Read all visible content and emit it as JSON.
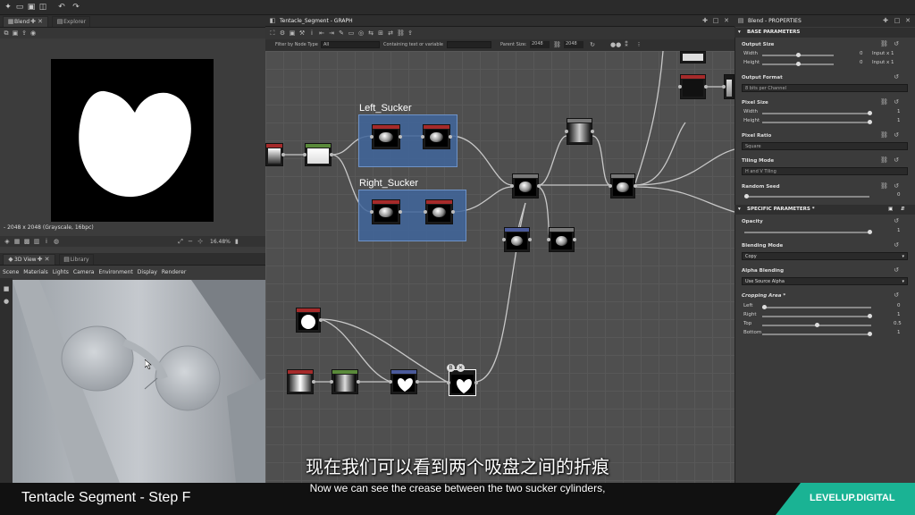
{
  "topbar": {
    "icons": [
      "new-file-icon",
      "open-icon",
      "save-icon",
      "save-all-icon",
      "undo-icon",
      "redo-icon"
    ]
  },
  "blend_viewer": {
    "tabs": [
      {
        "label": "Blend"
      },
      {
        "label": "Explorer"
      }
    ],
    "zoom_status": "- 2048 x 2048 (Grayscale, 16bpc)",
    "zoom": "16.48%"
  },
  "view3d": {
    "tabs": [
      {
        "label": "3D View"
      },
      {
        "label": "Library"
      }
    ],
    "menu": [
      "Scene",
      "Materials",
      "Lights",
      "Camera",
      "Environment",
      "Display",
      "Renderer"
    ]
  },
  "graph": {
    "title": "Tentacle_Segment - GRAPH",
    "filter_label": "Filter by Node Type",
    "filter_value": "All",
    "containing_label": "Containing text or variable",
    "parent_size_label": "Parent Size:",
    "parent_size_value": "2048",
    "size_value": "2048",
    "frames": [
      {
        "title": "Left_Sucker"
      },
      {
        "title": "Right_Sucker"
      }
    ]
  },
  "properties": {
    "title": "Blend - PROPERTIES",
    "base_section": "BASE PARAMETERS",
    "specific_section": "SPECIFIC PARAMETERS *",
    "output_size": "Output Size",
    "width_label": "Width",
    "height_label": "Height",
    "width_value": "0",
    "height_value": "0",
    "width_mode": "Input x 1",
    "height_mode": "Input x 1",
    "output_format": "Output Format",
    "output_format_value": "8 bits per Channel",
    "pixel_size": "Pixel Size",
    "pixel_w": "1",
    "pixel_h": "1",
    "pixel_ratio": "Pixel Ratio",
    "pixel_ratio_value": "Square",
    "tiling_mode": "Tiling Mode",
    "tiling_value": "H and V Tiling",
    "random_seed": "Random Seed",
    "random_seed_value": "0",
    "opacity": "Opacity",
    "opacity_value": "1",
    "blending_mode": "Blending Mode",
    "blending_value": "Copy",
    "alpha_blending": "Alpha Blending",
    "alpha_value": "Use Source Alpha",
    "cropping": "Cropping Area *",
    "left": "Left",
    "left_value": "0",
    "right": "Right",
    "right_value": "1",
    "top": "Top",
    "top_value": "0.5",
    "bottom": "Bottom",
    "bottom_value": "1"
  },
  "subtitle": {
    "cn": "现在我们可以看到两个吸盘之间的折痕",
    "en": "Now we can see the crease between the two sucker cylinders,"
  },
  "branding": {
    "step": "Tentacle Segment - Step F",
    "logo": "LEVELUP.DIGITAL"
  },
  "colors": {
    "frame_blue": "#40659b",
    "accent_green": "#1ab394",
    "node_label_green": "#7fd14a"
  }
}
